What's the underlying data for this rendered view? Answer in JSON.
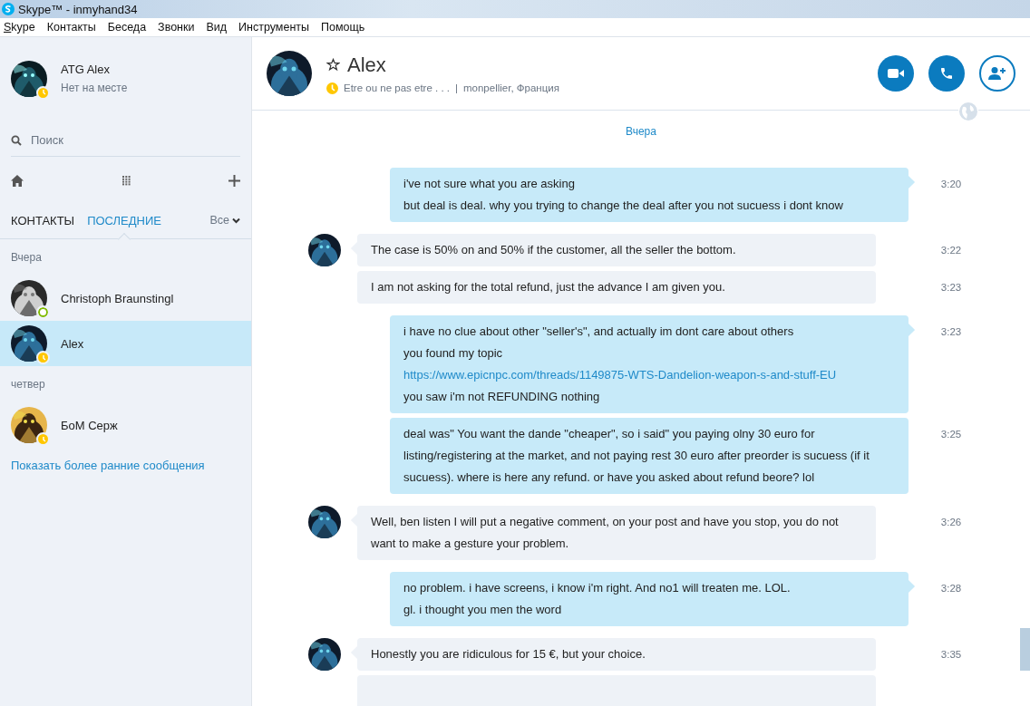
{
  "window": {
    "title": "Skype™ - inmyhand34"
  },
  "menu": [
    "Skype",
    "Контакты",
    "Беседа",
    "Звонки",
    "Вид",
    "Инструменты",
    "Помощь"
  ],
  "profile": {
    "name": "ATG Alex",
    "status_text": "Нет на месте",
    "away": true
  },
  "search": {
    "placeholder": "Поиск"
  },
  "tabs": [
    {
      "label": "КОНТАКТЫ",
      "selected": false
    },
    {
      "label": "ПОСЛЕДНИЕ",
      "selected": true
    }
  ],
  "filter": {
    "label": "Все"
  },
  "sections": [
    {
      "title": "Вчера",
      "contacts": [
        {
          "name": "Christoph Braunstingl",
          "away": false,
          "selected": false
        },
        {
          "name": "Alex",
          "away": true,
          "selected": true
        }
      ]
    },
    {
      "title": "четвер",
      "contacts": [
        {
          "name": "БоМ Серж",
          "away": true,
          "selected": false
        }
      ]
    }
  ],
  "show_earlier": "Показать более ранние сообщения",
  "chat": {
    "name": "Alex",
    "away": true,
    "mood": "Etre ou ne pas etre . . .",
    "separator": "|",
    "location": "monpellier, Франция",
    "date_label": "Вчера",
    "groups": [
      {
        "kind": "sent",
        "bubbles": [
          {
            "time": "3:20",
            "lines": [
              {
                "kind": "text",
                "text": "i've not sure what you are asking"
              },
              {
                "kind": "text",
                "text": "but deal is deal. why you trying to change the deal after you not sucuess i dont know"
              }
            ]
          }
        ]
      },
      {
        "kind": "received",
        "bubbles": [
          {
            "time": "3:22",
            "lines": [
              {
                "kind": "text",
                "text": "The case is 50% on and 50% if the customer, all the seller the bottom."
              }
            ]
          },
          {
            "time": "3:23",
            "lines": [
              {
                "kind": "text",
                "text": "I am not asking for the total refund, just the advance I am given you."
              }
            ]
          }
        ]
      },
      {
        "kind": "sent",
        "bubbles": [
          {
            "time": "3:23",
            "lines": [
              {
                "kind": "text",
                "text": "i have no clue about other \"seller's\", and actually im dont care about others"
              },
              {
                "kind": "text",
                "text": "you found my topic"
              },
              {
                "kind": "link",
                "text": "https://www.epicnpc.com/threads/1149875-WTS-Dandelion-weapon-s-and-stuff-EU"
              },
              {
                "kind": "text",
                "text": "you saw i'm not REFUNDING nothing"
              }
            ]
          },
          {
            "time": "3:25",
            "lines": [
              {
                "kind": "text",
                "text": "deal was\" You want the dande \"cheaper\", so i said\" you paying olny 30 euro for listing/registering at the market, and not paying rest 30 euro after preorder is sucuess (if it sucuess). where is here any refund. or have you asked about refund beore? lol"
              }
            ]
          }
        ]
      },
      {
        "kind": "received",
        "bubbles": [
          {
            "time": "3:26",
            "lines": [
              {
                "kind": "text",
                "text": "Well, ben listen I will put a negative comment, on your post and have you stop, you do not want to make a gesture your problem."
              }
            ]
          }
        ]
      },
      {
        "kind": "sent",
        "bubbles": [
          {
            "time": "3:28",
            "lines": [
              {
                "kind": "text",
                "text": "no problem. i have screens, i know i'm right. And no1 will treaten me. LOL."
              },
              {
                "kind": "text",
                "text": "gl. i thought you men the word"
              }
            ]
          }
        ]
      },
      {
        "kind": "received",
        "more_below": true,
        "bubbles": [
          {
            "time": "3:35",
            "lines": [
              {
                "kind": "text",
                "text": "Honestly you are ridiculous for 15 €, but your choice."
              }
            ]
          }
        ]
      }
    ]
  }
}
